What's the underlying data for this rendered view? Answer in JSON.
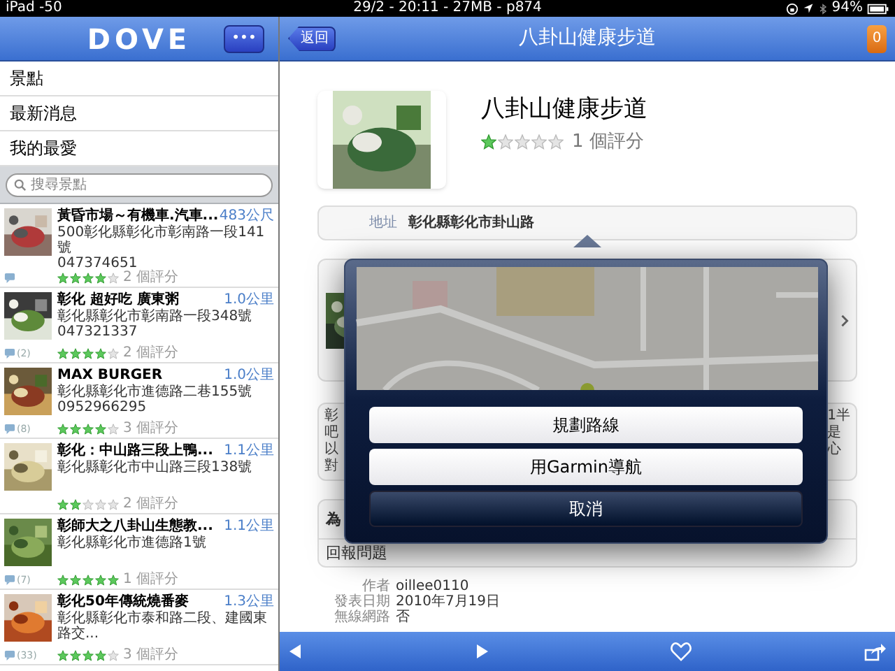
{
  "status_bar": {
    "carrier": "iPad -50",
    "center": "29/2 - 20:11 - 27MB - p874",
    "battery": "94%"
  },
  "sidebar": {
    "logo": "DOVE",
    "more_button": "•••",
    "menu": [
      {
        "label": "景點"
      },
      {
        "label": "最新消息"
      },
      {
        "label": "我的最愛"
      }
    ],
    "search": {
      "placeholder": "搜尋景點"
    },
    "places": [
      {
        "title": "黃昏市場～有機車.汽車...",
        "distance": "483公尺",
        "address": "500彰化縣彰化市彰南路一段141號",
        "phone": "047374651",
        "has_comments": true,
        "stars": 4,
        "ratings": "2 個評分"
      },
      {
        "title": "彰化 超好吃 廣東粥",
        "distance": "1.0公里",
        "address": "彰化縣彰化市彰南路一段348號",
        "phone": "047321337",
        "has_comments": true,
        "comments": "(2)",
        "stars": 4,
        "ratings": "2 個評分"
      },
      {
        "title": "MAX BURGER",
        "distance": "1.0公里",
        "address": "彰化縣彰化市進德路二巷155號",
        "phone": "0952966295",
        "has_comments": true,
        "comments": "(8)",
        "stars": 4,
        "ratings": "3 個評分"
      },
      {
        "title": "彰化：中山路三段上鴨...",
        "distance": "1.1公里",
        "address": "彰化縣彰化市中山路三段138號",
        "has_comments": false,
        "stars": 2,
        "ratings": "2 個評分"
      },
      {
        "title": "彰師大之八卦山生態教...",
        "distance": "1.1公里",
        "address": "彰化縣彰化市進德路1號",
        "has_comments": true,
        "comments": "(7)",
        "stars": 5,
        "ratings": "1 個評分"
      },
      {
        "title": "彰化50年傳統燒番麥",
        "distance": "1.3公里",
        "address": "彰化縣彰化市泰和路二段、建國東路交...",
        "has_comments": true,
        "comments": "(33)",
        "stars": 4,
        "ratings": "3 個評分"
      }
    ]
  },
  "detail": {
    "back": "返回",
    "title": "八卦山健康步道",
    "badge": "0",
    "name": "八卦山健康步道",
    "stars": 1,
    "ratings": "1 個評分",
    "address_label": "地址",
    "address": "彰化縣彰化市卦山路",
    "description_left": [
      "彰",
      "吧",
      "以",
      "對"
    ],
    "description_right": [
      "1半",
      "是",
      "心"
    ],
    "section_fragment": "為",
    "report": "回報問題",
    "meta": [
      {
        "label": "作者",
        "value": "oillee0110"
      },
      {
        "label": "發表日期",
        "value": "2010年7月19日"
      },
      {
        "label": "無線網路",
        "value": "否"
      }
    ]
  },
  "popover": {
    "actions": [
      {
        "label": "規劃路線",
        "kind": "default"
      },
      {
        "label": "用Garmin導航",
        "kind": "default"
      },
      {
        "label": "取消",
        "kind": "cancel"
      }
    ]
  }
}
